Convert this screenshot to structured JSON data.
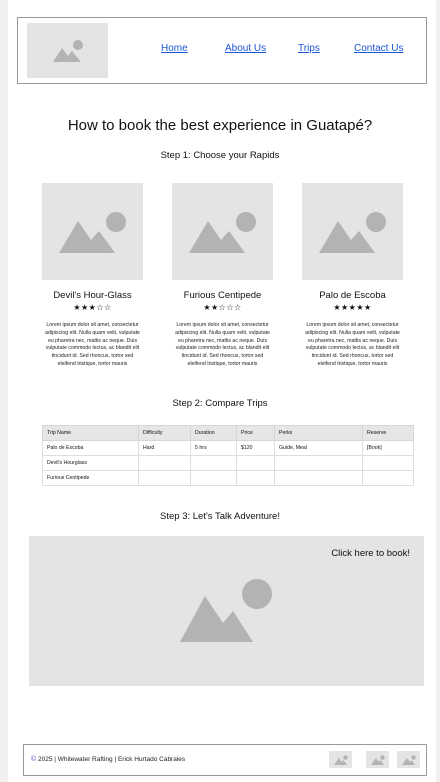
{
  "header": {
    "logo_icon": "image-placeholder-icon",
    "nav": {
      "home": "Home",
      "about": "About Us",
      "trips": "Trips",
      "contact": "Contact Us"
    }
  },
  "main": {
    "title": "How to book the best experience in Guatapé?",
    "step1": "Step 1: Choose your Rapids",
    "step2": "Step 2: Compare Trips",
    "step3": "Step 3: Let's Talk Adventure!"
  },
  "cards": [
    {
      "name": "Devil's Hour-Glass",
      "stars": "★★★☆☆",
      "rating": 3,
      "desc": "Lorem ipsum dolor sit amet, consectetur adipiscing elit. Nulla quam velit, vulputate eu pharetra nec, mattis ac neque. Duis vulputate commodo lectus, ac blandit elit tincidunt id. Sed rhoncus, tortor sed eleifend tristique, tortor mauris"
    },
    {
      "name": "Furious Centipede",
      "stars": "★★☆☆☆",
      "rating": 2,
      "desc": "Lorem ipsum dolor sit amet, consectetur adipiscing elit. Nulla quam velit, vulputate eu pharetra nec, mattis ac neque. Duis vulputate commodo lectus, ac blandit elit tincidunt id. Sed rhoncus, tortor sed eleifend tristique, tortor mauris"
    },
    {
      "name": "Palo de Escoba",
      "stars": "★★★★★",
      "rating": 5,
      "desc": "Lorem ipsum dolor sit amet, consectetur adipiscing elit. Nulla quam velit, vulputate eu pharetra nec, mattis ac neque. Duis vulputate commodo lectus, ac blandit elit tincidunt id. Sed rhoncus, tortor sed eleifend tristique, tortor mauris"
    }
  ],
  "table": {
    "headers": [
      "Trip Name",
      "Difficulty",
      "Duration",
      "Price",
      "Perks",
      "Reserve"
    ],
    "rows": [
      [
        "Palo de Escoba",
        "Hard",
        "5 hrs",
        "$120",
        "Guide, Meal",
        "[Book]"
      ],
      [
        "Devil's Hourglass",
        "",
        "",
        "",
        "",
        ""
      ],
      [
        "Furious Centipede",
        "",
        "",
        "",
        "",
        ""
      ]
    ]
  },
  "booking": {
    "cta": "Click here to book!"
  },
  "footer": {
    "copyright_symbol": "©",
    "text": "2025 | Whitewater Rafting | Erick Hurtado Cabrales",
    "social_icons": [
      "image-placeholder-icon",
      "image-placeholder-icon",
      "image-placeholder-icon"
    ]
  },
  "colors": {
    "link": "#1a56d6",
    "placeholder_bg": "#e4e4e4",
    "placeholder_icon": "#b3b3b3"
  }
}
